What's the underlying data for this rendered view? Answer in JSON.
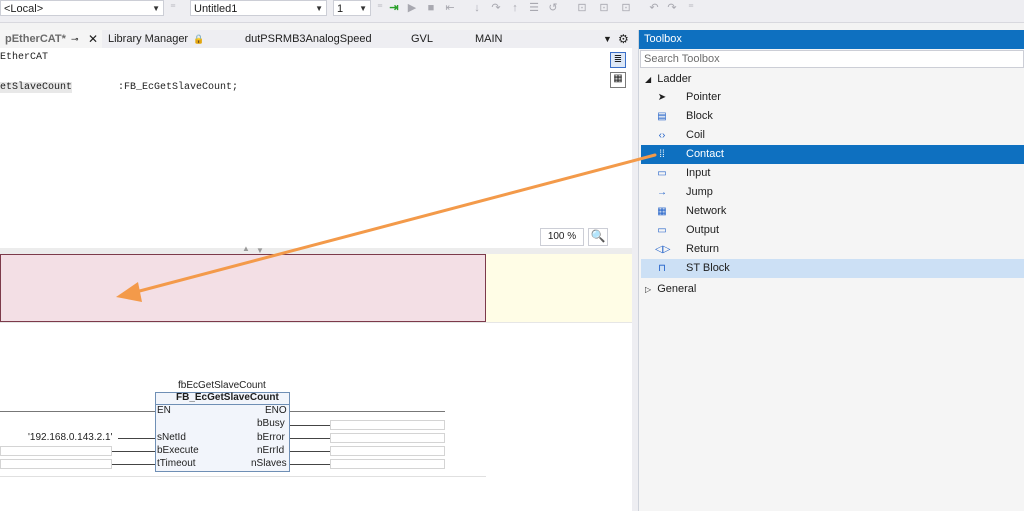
{
  "toolbar": {
    "target_combo": "<Local>",
    "project_combo": "Untitled1",
    "instance_combo": "1"
  },
  "tabs": [
    {
      "label": "pEtherCAT*"
    },
    {
      "label": "Library Manager"
    },
    {
      "label": "dutPSRMB3AnalogSpeed"
    },
    {
      "label": "GVL"
    },
    {
      "label": "MAIN"
    }
  ],
  "editor": {
    "line1": "EtherCAT",
    "var_name": "etSlaveCount",
    "var_type": ":FB_EcGetSlaveCount;",
    "zoom": "100 %"
  },
  "toolbox": {
    "title": "Toolbox",
    "search_placeholder": "Search Toolbox",
    "group_ladder": "Ladder",
    "group_general": "General",
    "items": [
      {
        "label": "Pointer",
        "icon": "pointer-icon"
      },
      {
        "label": "Block",
        "icon": "block-icon"
      },
      {
        "label": "Coil",
        "icon": "coil-icon"
      },
      {
        "label": "Contact",
        "icon": "contact-icon"
      },
      {
        "label": "Input",
        "icon": "input-icon"
      },
      {
        "label": "Jump",
        "icon": "jump-icon"
      },
      {
        "label": "Network",
        "icon": "network-icon"
      },
      {
        "label": "Output",
        "icon": "output-icon"
      },
      {
        "label": "Return",
        "icon": "return-icon"
      },
      {
        "label": "ST Block",
        "icon": "st-block-icon"
      }
    ]
  },
  "fb": {
    "instance": "fbEcGetSlaveCount",
    "type": "FB_EcGetSlaveCount",
    "inputs": [
      "EN",
      "sNetId",
      "bExecute",
      "tTimeout"
    ],
    "outputs": [
      "ENO",
      "bBusy",
      "bError",
      "nErrId",
      "nSlaves"
    ],
    "netid_value": "'192.168.0.143.2.1'"
  },
  "colors": {
    "accent": "#0e70c0",
    "arrow": "#f39a4a",
    "comment_bg": "#f3dfe5",
    "comment_border": "#7c3a4a"
  }
}
